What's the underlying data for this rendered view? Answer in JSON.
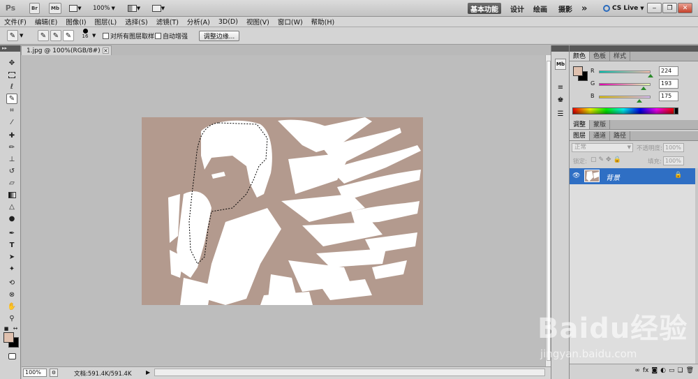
{
  "appbar": {
    "logo": "Ps",
    "bridge": "Br",
    "minibridge": "Mb",
    "zoom": "100%",
    "workspaces": [
      "基本功能",
      "设计",
      "绘画",
      "摄影"
    ],
    "more": "»",
    "cslive": "CS Live",
    "win_minimize": "‒",
    "win_restore": "❐",
    "win_close": "✕"
  },
  "menu": [
    "文件(F)",
    "编辑(E)",
    "图像(I)",
    "图层(L)",
    "选择(S)",
    "滤镜(T)",
    "分析(A)",
    "3D(D)",
    "视图(V)",
    "窗口(W)",
    "帮助(H)"
  ],
  "options": {
    "brush_size": "16",
    "sample_all_layers": "对所有图层取样",
    "auto_enhance": "自动增强",
    "refine_edge": "调整边缘..."
  },
  "document": {
    "tab_title": "1.jpg @ 100%(RGB/8#) *",
    "tab_close": "×",
    "status_zoom": "100%",
    "status_info": "文档:591.4K/591.4K"
  },
  "color_panel": {
    "tabs": [
      "颜色",
      "色板",
      "样式"
    ],
    "channels": [
      {
        "label": "R",
        "value": "224"
      },
      {
        "label": "G",
        "value": "193"
      },
      {
        "label": "B",
        "value": "175"
      }
    ],
    "foreground": "#e0c1af",
    "background": "#000000"
  },
  "adjust_panel": {
    "tabs": [
      "调整",
      "蒙版"
    ]
  },
  "layers_panel": {
    "tabs": [
      "图层",
      "通道",
      "路径"
    ],
    "blend_mode": "正常",
    "opacity_label": "不透明度:",
    "opacity_value": "100%",
    "lock_label": "锁定:",
    "fill_label": "填充:",
    "fill_value": "100%",
    "layers": [
      {
        "name": "背景",
        "locked": true
      }
    ]
  },
  "image_colors": {
    "base": "#b39a8e",
    "highlight": "#ffffff"
  },
  "watermark": {
    "brand": "Baidu经验",
    "url": "jingyan.baidu.com"
  }
}
